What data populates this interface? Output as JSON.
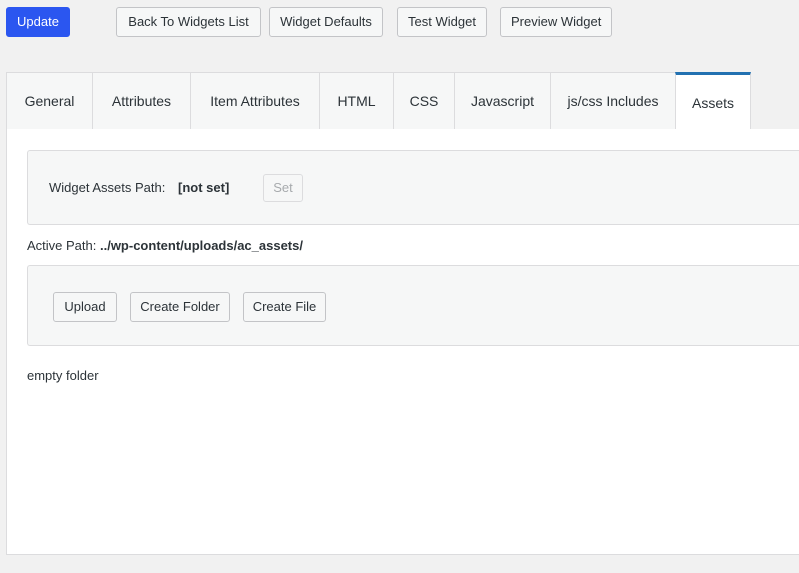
{
  "toolbar": {
    "update_label": "Update",
    "back_label": "Back To Widgets List",
    "defaults_label": "Widget Defaults",
    "test_label": "Test Widget",
    "preview_label": "Preview Widget"
  },
  "tabs": [
    {
      "label": "General",
      "active": false
    },
    {
      "label": "Attributes",
      "active": false
    },
    {
      "label": "Item Attributes",
      "active": false
    },
    {
      "label": "HTML",
      "active": false
    },
    {
      "label": "CSS",
      "active": false
    },
    {
      "label": "Javascript",
      "active": false
    },
    {
      "label": "js/css Includes",
      "active": false
    },
    {
      "label": "Assets",
      "active": true
    }
  ],
  "assets": {
    "path_label": "Widget Assets Path:",
    "path_value": "[not set]",
    "set_label": "Set",
    "active_path_label": "Active Path:",
    "active_path_value": "../wp-content/uploads/ac_assets/",
    "upload_label": "Upload",
    "create_folder_label": "Create Folder",
    "create_file_label": "Create File",
    "empty_note": "empty folder"
  },
  "colors": {
    "primary": "#2b56f0",
    "active_tab_accent": "#2271b1",
    "background": "#f1f1f1"
  }
}
